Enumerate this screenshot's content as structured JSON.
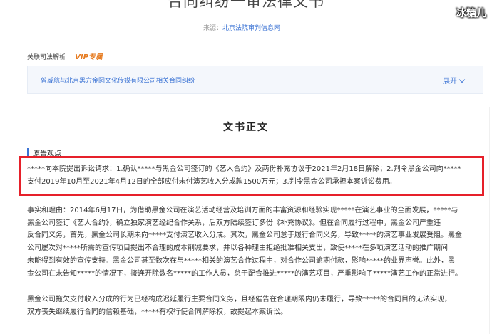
{
  "header": {
    "title": "合同纠纷一审法律文书",
    "source_label": "来源：",
    "source_link": "北京法院审判信息网"
  },
  "watermark": "冰糖儿",
  "related": {
    "label": "关联司法解析",
    "vip": "VIP专属",
    "link": "曾威航与北京黑方金圆文化传媒有限公司相关合同纠纷",
    "expand": "展开"
  },
  "body": {
    "section_title": "文书正文",
    "sub_heading": "原告观点",
    "claim_lines": [
      "*****向本院提出诉讼请求：1.确认*****与黑金公司签订的《艺人合约》及两份补充协议于2021年2月18日解除；2.判令黑金公司向*****",
      "支付2019年10月至2021年4月12日的全部应付未付演艺收入分成款1500万元；3.判令黑金公司承担本案诉讼费用。"
    ],
    "facts_lines": [
      "事实和理由：2014年6月17日，为借助黑金公司在演艺活动经营及培训方面的丰富资源和经验实现*****在演艺事业的全面发展，*****与",
      "黑金公司签订《艺人合约》，确立独家演艺经纪合作关系，后双方陆续签订多份《补充协议》。但在合同履行过程中，黑金公司严重违",
      "反合同义务，首先，黑金公司长期未向*****支付演艺收入分成。其次，黑金公司怠于履行合同义务，导致*****的演艺事业发展受阻。黑金",
      "公司屡次对*****所需的宣传项目提出不合理的成本削减要求，并以各种理由拒绝批准相关支出，致使*****在多项演艺活动的推广期间",
      "未能得到有效的宣传支持。黑金公司甚至数次在与*****相关的演艺合作过程中，对合作公司逾期付款，影响*****的业界声誉。此外，黑",
      "金公司在未告知*****的情况下，接连开除数名*****的工作人员，怠于配合推进*****的演艺项目，严重影响了*****演艺工作的正常进行。"
    ],
    "final_lines": [
      "黑金公司拖欠支付收入分成的行为已经构成迟延履行主要合同义务，且经催告在合理期限内仍未履行，导致*****的合同目的无法实现，",
      "双方丧失继续履行合同的信赖基础，*****有权行使合同解除权，故提起本案诉讼。"
    ]
  }
}
